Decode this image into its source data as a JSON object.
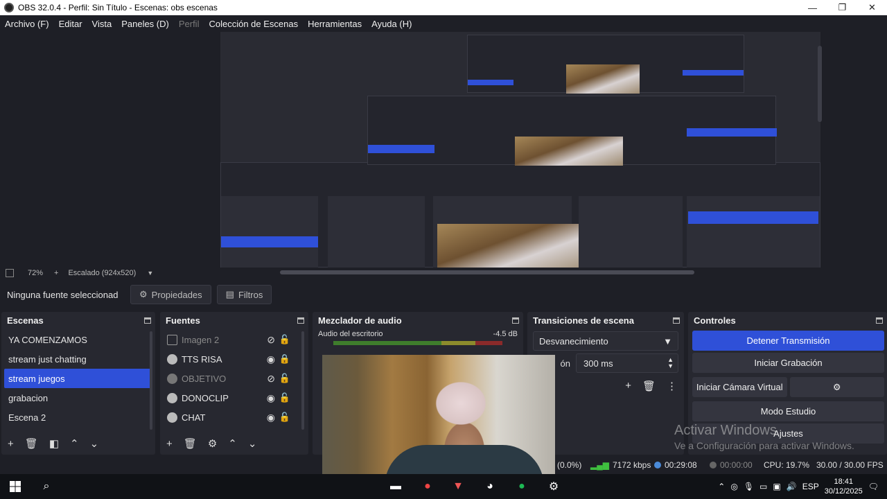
{
  "window": {
    "title": "OBS 32.0.4 - Perfil: Sin Título - Escenas: obs escenas",
    "minimize": "—",
    "restore": "❐",
    "close": "✕"
  },
  "menu": [
    {
      "label": "Archivo (F)",
      "disabled": false
    },
    {
      "label": "Editar",
      "disabled": false
    },
    {
      "label": "Vista",
      "disabled": false
    },
    {
      "label": "Paneles (D)",
      "disabled": false
    },
    {
      "label": "Perfil",
      "disabled": true
    },
    {
      "label": "Colección de Escenas",
      "disabled": false
    },
    {
      "label": "Herramientas",
      "disabled": false
    },
    {
      "label": "Ayuda (H)",
      "disabled": false
    }
  ],
  "preview_bar": {
    "zoom": "72%",
    "plus": "+",
    "scale_label": "Escalado (924x520)",
    "arrow": "▼"
  },
  "source_bar": {
    "no_source": "Ninguna fuente seleccionad",
    "properties": "Propiedades",
    "filters": "Filtros"
  },
  "scenes": {
    "title": "Escenas",
    "items": [
      "YA COMENZAMOS",
      "stream just chatting",
      "stream juegos",
      "grabacion",
      "Escena 2"
    ],
    "selected_index": 2
  },
  "sources": {
    "title": "Fuentes",
    "items": [
      {
        "name": "Imagen 2",
        "icon": "image-icon",
        "visible": false
      },
      {
        "name": "TTS RISA",
        "icon": "browser-icon",
        "visible": true
      },
      {
        "name": "OBJETIVO",
        "icon": "browser-icon",
        "visible": false
      },
      {
        "name": "DONOCLIP",
        "icon": "browser-icon",
        "visible": true
      },
      {
        "name": "CHAT",
        "icon": "browser-icon",
        "visible": true
      }
    ]
  },
  "mixer": {
    "title": "Mezclador de audio",
    "track_name": "Audio del escritorio",
    "track_level": "-4.5 dB"
  },
  "transitions": {
    "title": "Transiciones de escena",
    "selected": "Desvanecimiento",
    "duration_label": "ón",
    "duration_value": "300 ms"
  },
  "controls": {
    "title": "Controles",
    "stop_stream": "Detener Transmisión",
    "start_recording": "Iniciar Grabación",
    "virtual_camera": "Iniciar Cámara Virtual",
    "studio_mode": "Modo Estudio",
    "settings": "Ajustes"
  },
  "status": {
    "dropped": "(0.0%)",
    "bitrate": "7172 kbps",
    "live_time": "00:29:08",
    "rec_time": "00:00:00",
    "cpu": "CPU: 19.7%",
    "fps": "30.00 / 30.00 FPS"
  },
  "watermark": {
    "line1": "Activar Windows",
    "line2": "Ve a Configuración para activar Windows."
  },
  "taskbar": {
    "language": "ESP",
    "time": "18:41",
    "date": "30/12/2025"
  },
  "colors": {
    "accent": "#2f50d8",
    "background": "#1e1f26",
    "dock": "#272830"
  }
}
